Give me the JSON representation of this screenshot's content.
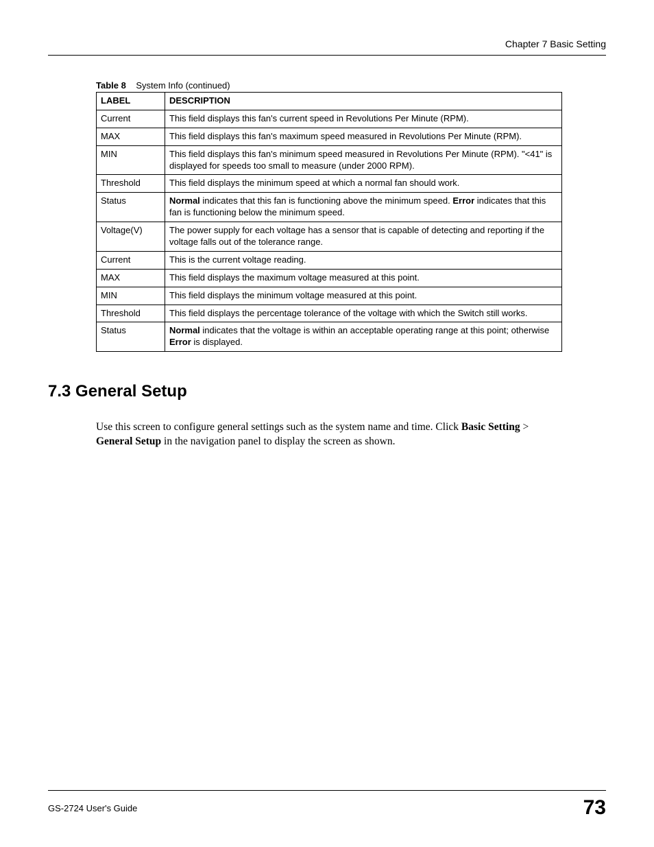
{
  "header": {
    "chapter": "Chapter 7 Basic Setting"
  },
  "tablecaption": {
    "prefix": "Table 8",
    "title": "System Info (continued)"
  },
  "table": {
    "headers": {
      "label": "LABEL",
      "desc": "DESCRIPTION"
    },
    "rows": [
      {
        "label": "Current",
        "desc_plain": "This field displays this fan's current speed in Revolutions Per Minute (RPM)."
      },
      {
        "label": "MAX",
        "desc_plain": "This field displays this fan's maximum speed measured in Revolutions Per Minute (RPM)."
      },
      {
        "label": "MIN",
        "desc_plain": "This field displays this fan's minimum speed measured in Revolutions Per Minute (RPM). \"<41\" is displayed for speeds too small to measure (under 2000 RPM)."
      },
      {
        "label": "Threshold",
        "desc_plain": "This field displays the minimum speed at which a normal fan should work."
      },
      {
        "label": "Status",
        "desc_bold_words": true,
        "b1": "Normal",
        "t1": " indicates that this fan is functioning above the minimum speed. ",
        "b2": "Error",
        "t2": " indicates that this fan is functioning below the minimum speed."
      },
      {
        "label": "Voltage(V)",
        "desc_plain": "The power supply for each voltage has a sensor that is capable of detecting and reporting if the voltage falls out of the tolerance range."
      },
      {
        "label": "Current",
        "desc_plain": "This is the current voltage reading."
      },
      {
        "label": "MAX",
        "desc_plain": "This field displays the maximum voltage measured at this point."
      },
      {
        "label": "MIN",
        "desc_plain": "This field displays the minimum voltage measured at this point."
      },
      {
        "label": "Threshold",
        "desc_plain": "This field displays the percentage tolerance of the voltage with which the Switch still works."
      },
      {
        "label": "Status",
        "desc_bold_words": true,
        "b1": "Normal",
        "t1": " indicates that the voltage is within an acceptable operating range at this point; otherwise ",
        "b2": "Error",
        "t2": " is displayed."
      }
    ]
  },
  "section": {
    "heading": "7.3  General Setup",
    "p_t1": "Use this screen to configure general settings such as the system name and time. Click ",
    "p_b1": "Basic Setting",
    "p_t2": " > ",
    "p_b2": "General Setup",
    "p_t3": " in the navigation panel to display the screen as shown."
  },
  "footer": {
    "guide": "GS-2724 User's Guide",
    "page": "73"
  }
}
